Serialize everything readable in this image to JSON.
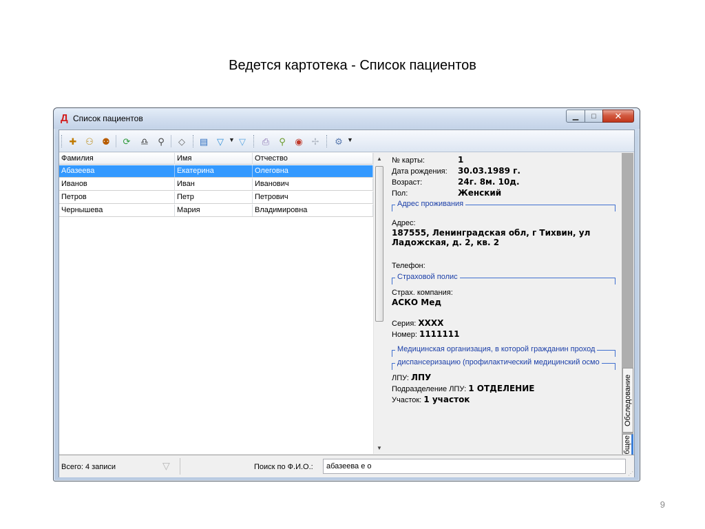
{
  "slide": {
    "title": "Ведется картотека  - Список пациентов",
    "page_number": "9"
  },
  "window": {
    "title": "Список пациентов",
    "icon": "patient-list-app-icon",
    "controls": {
      "minimize": "minimize-icon",
      "maximize": "maximize-icon",
      "close": "close-icon"
    }
  },
  "toolbar": {
    "buttons": [
      {
        "icon": "add-patient-icon"
      },
      {
        "icon": "edit-patient-icon"
      },
      {
        "icon": "delete-patient-icon"
      },
      {
        "icon": "refresh-icon"
      },
      {
        "icon": "find-icon"
      },
      {
        "icon": "find-next-icon"
      },
      {
        "icon": "eraser-icon"
      },
      {
        "icon": "columns-icon"
      },
      {
        "icon": "filter-icon"
      },
      {
        "icon": "filter-clear-icon"
      },
      {
        "icon": "print-icon"
      },
      {
        "icon": "user-search-icon"
      },
      {
        "icon": "globe-icon"
      },
      {
        "icon": "pin-icon"
      },
      {
        "icon": "settings-icon"
      }
    ],
    "colors": {
      "accent": "#3399ff"
    }
  },
  "grid": {
    "columns": [
      "Фамилия",
      "Имя",
      "Отчество"
    ],
    "rows": [
      [
        "Абазеева",
        "Екатерина",
        "Олеговна"
      ],
      [
        "Иванов",
        "Иван",
        "Иванович"
      ],
      [
        "Петров",
        "Петр",
        "Петрович"
      ],
      [
        "Чернышева",
        "Мария",
        "Владимировна"
      ]
    ],
    "selected_index": 0
  },
  "details": {
    "card_no_label": "№ карты:",
    "card_no": "1",
    "birth_label": "Дата рождения:",
    "birth": "30.03.1989 г.",
    "age_label": "Возраст:",
    "age": "24г. 8м. 10д.",
    "sex_label": "Пол:",
    "sex": "Женский",
    "residence_group": "Адрес проживания",
    "address_label": "Адрес:",
    "address_line1": "187555, Ленинградская обл, г Тихвин, ул",
    "address_line2": "Ладожская, д. 2, кв. 2",
    "phone_label": "Телефон:",
    "policy_group": "Страховой полис",
    "insurer_label": "Страх. компания:",
    "insurer": "АСКО Мед",
    "series_label": "Серия:",
    "series": "XXXX",
    "number_label": "Номер:",
    "number": "1111111",
    "med_org_group": "Медицинская организация, в которой гражданин проход",
    "dispensary_group": "диспансеризацию (профилактический медицинский осмо",
    "lpu_label": "ЛПУ:",
    "lpu": "ЛПУ",
    "subdivision_label": "Подразделение ЛПУ:",
    "subdivision": "1 ОТДЕЛЕНИЕ",
    "district_label": "Участок:",
    "district": "1 участок"
  },
  "side_tabs": [
    "Обследование",
    "Общее"
  ],
  "status": {
    "total": "Всего: 4 записи",
    "search_label": "Поиск по Ф.И.О.:",
    "search_value": "абазеева е о"
  }
}
